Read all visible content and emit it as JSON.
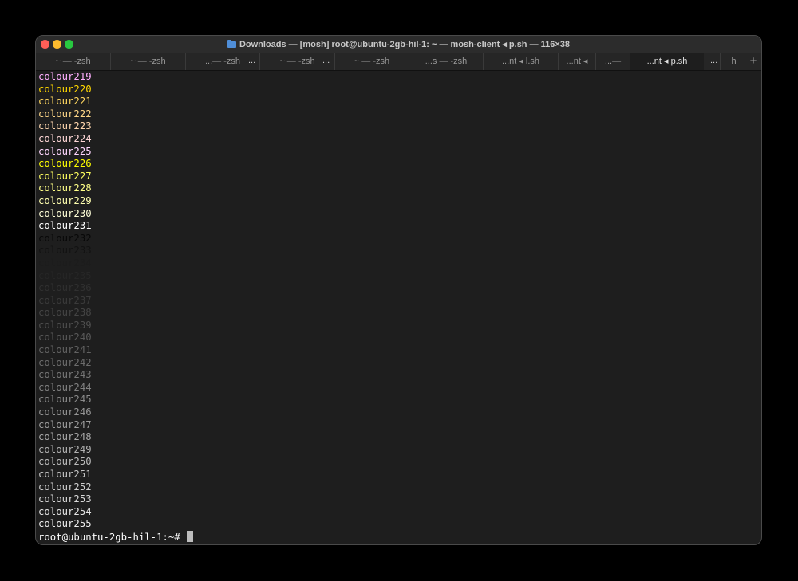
{
  "window": {
    "title": "Downloads — [mosh] root@ubuntu-2gb-hil-1: ~ — mosh-client ◂ p.sh — 116×38",
    "folder_icon": "folder-icon"
  },
  "tabs": [
    {
      "label": "~ — -zsh",
      "ellipsis": ""
    },
    {
      "label": "~ — -zsh",
      "ellipsis": ""
    },
    {
      "label": "...— -zsh",
      "ellipsis": "..."
    },
    {
      "label": "~ — -zsh",
      "ellipsis": "..."
    },
    {
      "label": "~ — -zsh",
      "ellipsis": ""
    },
    {
      "label": "...s — -zsh",
      "ellipsis": ""
    },
    {
      "label": "...nt ◂ l.sh",
      "ellipsis": ""
    },
    {
      "label": "...nt ◂",
      "ellipsis": ""
    },
    {
      "label": "...—",
      "ellipsis": ""
    },
    {
      "label": "...nt ◂ p.sh",
      "ellipsis": "...",
      "active": true
    },
    {
      "label": "h",
      "ellipsis": ""
    }
  ],
  "add_tab_label": "+",
  "terminal": {
    "lines": [
      {
        "text": "colour219",
        "color": "#ffafff"
      },
      {
        "text": "colour220",
        "color": "#ffd700"
      },
      {
        "text": "colour221",
        "color": "#ffd75f"
      },
      {
        "text": "colour222",
        "color": "#ffd787"
      },
      {
        "text": "colour223",
        "color": "#ffd7af"
      },
      {
        "text": "colour224",
        "color": "#ffd7d7"
      },
      {
        "text": "colour225",
        "color": "#ffd7ff"
      },
      {
        "text": "colour226",
        "color": "#ffff00"
      },
      {
        "text": "colour227",
        "color": "#ffff5f"
      },
      {
        "text": "colour228",
        "color": "#ffff87"
      },
      {
        "text": "colour229",
        "color": "#ffffaf"
      },
      {
        "text": "colour230",
        "color": "#ffffd7"
      },
      {
        "text": "colour231",
        "color": "#ffffff"
      },
      {
        "text": "colour232",
        "color": "#080808"
      },
      {
        "text": "colour233",
        "color": "#121212"
      },
      {
        "text": "colour234",
        "color": "#1c1c1c"
      },
      {
        "text": "colour235",
        "color": "#262626"
      },
      {
        "text": "colour236",
        "color": "#303030"
      },
      {
        "text": "colour237",
        "color": "#3a3a3a"
      },
      {
        "text": "colour238",
        "color": "#444444"
      },
      {
        "text": "colour239",
        "color": "#4e4e4e"
      },
      {
        "text": "colour240",
        "color": "#585858"
      },
      {
        "text": "colour241",
        "color": "#626262"
      },
      {
        "text": "colour242",
        "color": "#6c6c6c"
      },
      {
        "text": "colour243",
        "color": "#767676"
      },
      {
        "text": "colour244",
        "color": "#808080"
      },
      {
        "text": "colour245",
        "color": "#8a8a8a"
      },
      {
        "text": "colour246",
        "color": "#949494"
      },
      {
        "text": "colour247",
        "color": "#9e9e9e"
      },
      {
        "text": "colour248",
        "color": "#a8a8a8"
      },
      {
        "text": "colour249",
        "color": "#b2b2b2"
      },
      {
        "text": "colour250",
        "color": "#bcbcbc"
      },
      {
        "text": "colour251",
        "color": "#c6c6c6"
      },
      {
        "text": "colour252",
        "color": "#d0d0d0"
      },
      {
        "text": "colour253",
        "color": "#dadada"
      },
      {
        "text": "colour254",
        "color": "#e4e4e4"
      },
      {
        "text": "colour255",
        "color": "#eeeeee"
      }
    ],
    "prompt": "root@ubuntu-2gb-hil-1:~# ",
    "prompt_color": "#ffffff",
    "cursor_color": "#bdbdbd"
  },
  "colors": {
    "close": "#ff5f57",
    "minimize": "#febc2e",
    "maximize": "#28c840",
    "terminal_bg": "#1e1e1e",
    "titlebar_bg": "#2c2c2c"
  }
}
